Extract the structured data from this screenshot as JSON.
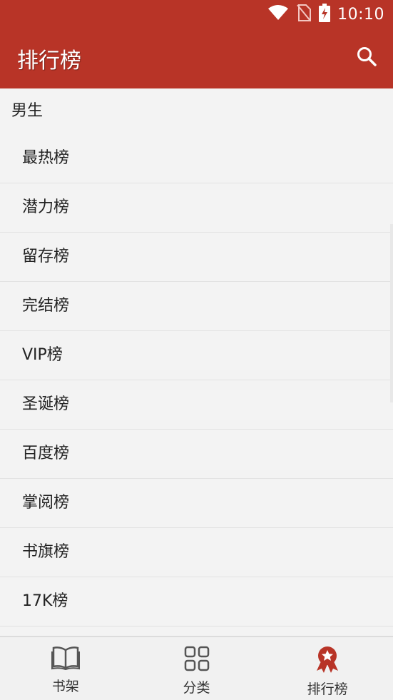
{
  "status": {
    "time": "10:10",
    "icons": [
      "wifi-icon",
      "no-sim-icon",
      "battery-charging-icon"
    ]
  },
  "appbar": {
    "title": "排行榜",
    "search_icon": "search-icon"
  },
  "section": {
    "title": "男生",
    "items": [
      {
        "label": "最热榜"
      },
      {
        "label": "潜力榜"
      },
      {
        "label": "留存榜"
      },
      {
        "label": "完结榜"
      },
      {
        "label": "VIP榜"
      },
      {
        "label": "圣诞榜"
      },
      {
        "label": "百度榜"
      },
      {
        "label": "掌阅榜"
      },
      {
        "label": "书旗榜"
      },
      {
        "label": "17K榜"
      }
    ]
  },
  "bottom_nav": [
    {
      "label": "书架",
      "icon": "book-icon"
    },
    {
      "label": "分类",
      "icon": "grid-icon"
    },
    {
      "label": "排行榜",
      "icon": "ranking-medal-icon",
      "active": true
    }
  ],
  "colors": {
    "primary": "#b83427",
    "background": "#f3f3f3"
  }
}
